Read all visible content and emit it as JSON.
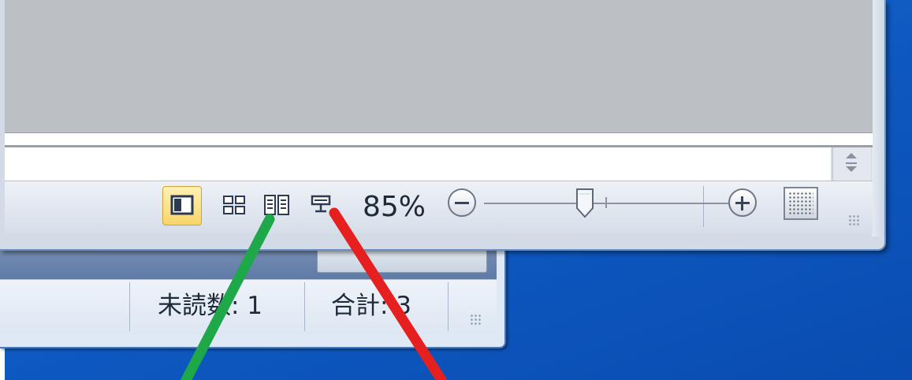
{
  "back_window": {
    "status_unread": "未読数: 1",
    "status_total": "合計: 3"
  },
  "front_window": {
    "view_buttons": [
      "print-layout",
      "full-screen-reading",
      "web-layout",
      "outline"
    ],
    "zoom": {
      "label": "85%",
      "level_percent": 85
    }
  },
  "annotations": {
    "green_line_color": "#1fa84a",
    "red_line_color": "#e5201f"
  }
}
